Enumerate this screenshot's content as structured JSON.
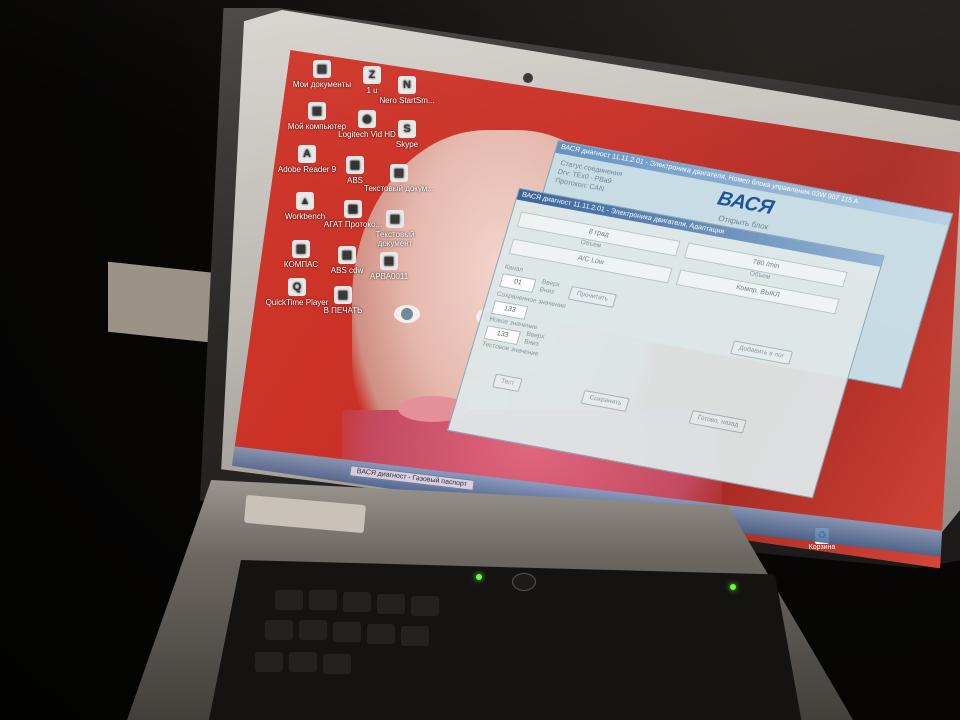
{
  "desktop_icons": [
    {
      "id": "my_docs",
      "label": "Мои документы",
      "glyph": "▤"
    },
    {
      "id": "i_u",
      "label": "1 u",
      "glyph": "Z"
    },
    {
      "id": "nero",
      "label": "Nero StartSm...",
      "glyph": "N"
    },
    {
      "id": "my_computer",
      "label": "Мой компьютер",
      "glyph": "▣"
    },
    {
      "id": "logitech",
      "label": "Logitech Vid HD",
      "glyph": "◉"
    },
    {
      "id": "skype",
      "label": "Skype",
      "glyph": "S"
    },
    {
      "id": "adobe",
      "label": "Adobe Reader 9",
      "glyph": "A"
    },
    {
      "id": "abs",
      "label": "ABS",
      "glyph": "▦"
    },
    {
      "id": "text_doc",
      "label": "Текстовый докум...",
      "glyph": "▤"
    },
    {
      "id": "workbench",
      "label": "Workbench",
      "glyph": "▲"
    },
    {
      "id": "agat",
      "label": "АГАТ Протоко...",
      "glyph": "▦"
    },
    {
      "id": "text_doc2",
      "label": "Текстовый документ",
      "glyph": "▤"
    },
    {
      "id": "kompas",
      "label": "КОМПАС",
      "glyph": "▥"
    },
    {
      "id": "abs_cdw",
      "label": "ABS cdw",
      "glyph": "▤"
    },
    {
      "id": "ap",
      "label": "АРВА0011",
      "glyph": "▤"
    },
    {
      "id": "quicktime",
      "label": "QuickTime Player",
      "glyph": "Q"
    },
    {
      "id": "print",
      "label": "В ПЕЧАТЬ",
      "glyph": "▤"
    }
  ],
  "taskbar": {
    "active_task": "ВАСЯ диагност - Газовый паспорт"
  },
  "recycle_bin": {
    "label": "Корзина",
    "glyph": "♻"
  },
  "app_window_back": {
    "title": "ВАСЯ диагност 11.11.2.01 - Электроника двигателя, Номер блока управления 03W 907 115 A",
    "status_lines": [
      "Статус соединения",
      "Drv: TEx0 - РВа9",
      "Протокол: CAN"
    ],
    "brand": "ВАСЯ",
    "subtitle": "Открыть блок"
  },
  "app_window_front": {
    "title": "ВАСЯ диагност 11.11.2.01 - Электроника двигателя, Адаптация",
    "rows": [
      {
        "value": "8 град",
        "label": "Объем"
      },
      {
        "value": "А/С Low",
        "label": ""
      },
      {
        "value": "780 /min",
        "label": "Объем"
      },
      {
        "value": "Компр. ВЫКЛ",
        "label": ""
      }
    ],
    "channel_label": "Канал",
    "channel_value": "01",
    "stored_label": "Сохраненное значение",
    "stored_value": "133",
    "new_label": "Новое значение",
    "new_value": "133",
    "test_label": "Тестовое значение",
    "buttons": {
      "up": "Вверх",
      "down": "Вниз",
      "read": "Прочитать",
      "add_log": "Добавить в лог",
      "test": "Тест",
      "save": "Сохранить",
      "back": "Готово, назад"
    }
  },
  "colors": {
    "wallpaper": "#c92f25",
    "window_title": "#5f8fc1",
    "brand_text": "#1a4e9a"
  }
}
